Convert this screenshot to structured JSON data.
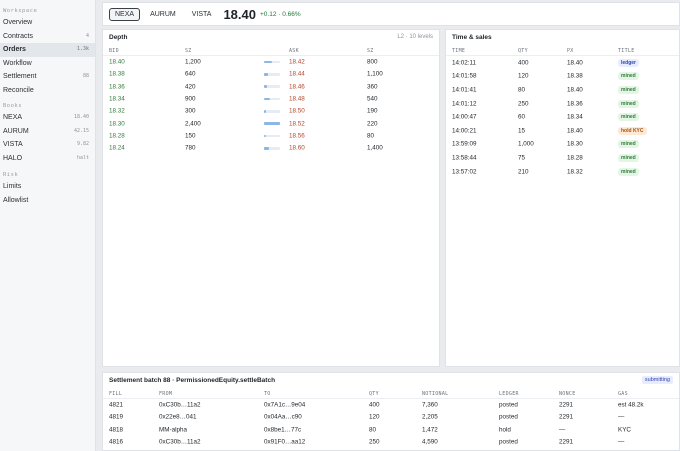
{
  "sidebar": {
    "sections": [
      {
        "title": "Workspace",
        "items": [
          {
            "label": "Overview",
            "count": ""
          },
          {
            "label": "Contracts",
            "count": "4"
          },
          {
            "label": "Orders",
            "count": "1.3k",
            "active": true
          },
          {
            "label": "Workflow",
            "count": ""
          },
          {
            "label": "Settlement",
            "count": "88"
          },
          {
            "label": "Reconcile",
            "count": ""
          }
        ]
      },
      {
        "title": "Books",
        "items": [
          {
            "label": "NEXA",
            "count": "18.40"
          },
          {
            "label": "AURUM",
            "count": "42.15"
          },
          {
            "label": "VISTA",
            "count": "9.82"
          },
          {
            "label": "HALO",
            "count": "halt"
          }
        ]
      },
      {
        "title": "Risk",
        "items": [
          {
            "label": "Limits",
            "count": ""
          },
          {
            "label": "Allowlist",
            "count": ""
          }
        ]
      }
    ]
  },
  "topbar": {
    "tickers": [
      "NEXA",
      "AURUM",
      "VISTA"
    ],
    "active_ticker": "NEXA",
    "price": "18.40",
    "change": "+0.12 · 0.66%"
  },
  "depth": {
    "title": "Depth",
    "meta": "L2 · 10 levels",
    "headers": {
      "bid": "BID",
      "bid_size": "SZ",
      "ask": "ASK",
      "ask_size": "SZ"
    },
    "rows": [
      {
        "bid": "18.40",
        "bid_size": "1,200",
        "ask": "18.42",
        "ask_size": "800"
      },
      {
        "bid": "18.38",
        "bid_size": "640",
        "ask": "18.44",
        "ask_size": "1,100"
      },
      {
        "bid": "18.36",
        "bid_size": "420",
        "ask": "18.46",
        "ask_size": "360"
      },
      {
        "bid": "18.34",
        "bid_size": "900",
        "ask": "18.48",
        "ask_size": "540"
      },
      {
        "bid": "18.32",
        "bid_size": "300",
        "ask": "18.50",
        "ask_size": "190"
      },
      {
        "bid": "18.30",
        "bid_size": "2,400",
        "ask": "18.52",
        "ask_size": "220"
      },
      {
        "bid": "18.28",
        "bid_size": "150",
        "ask": "18.56",
        "ask_size": "80"
      },
      {
        "bid": "18.24",
        "bid_size": "780",
        "ask": "18.60",
        "ask_size": "1,400"
      }
    ],
    "colors": {
      "bid": "#2f7d3a",
      "ask": "#b2452b",
      "bar": "#8cb6e3"
    }
  },
  "time_sales": {
    "title": "Time & sales",
    "headers": {
      "time": "TIME",
      "qty": "QTY",
      "px": "PX",
      "title": "TITLE"
    },
    "rows": [
      {
        "time": "14:02:11",
        "qty": "400",
        "px": "18.40",
        "title": "ledger"
      },
      {
        "time": "14:01:58",
        "qty": "120",
        "px": "18.38",
        "title": "mined"
      },
      {
        "time": "14:01:41",
        "qty": "80",
        "px": "18.40",
        "title": "mined"
      },
      {
        "time": "14:01:12",
        "qty": "250",
        "px": "18.36",
        "title": "mined"
      },
      {
        "time": "14:00:47",
        "qty": "60",
        "px": "18.34",
        "title": "mined"
      },
      {
        "time": "14:00:21",
        "qty": "15",
        "px": "18.40",
        "title": "hold KYC"
      },
      {
        "time": "13:59:09",
        "qty": "1,000",
        "px": "18.30",
        "title": "mined"
      },
      {
        "time": "13:58:44",
        "qty": "75",
        "px": "18.28",
        "title": "mined"
      },
      {
        "time": "13:57:02",
        "qty": "210",
        "px": "18.32",
        "title": "mined"
      }
    ]
  },
  "settlement": {
    "title": "Settlement batch 88 · PermissionedEquity.settleBatch",
    "status": "submitting",
    "headers": {
      "fill": "FILL",
      "from": "FROM",
      "to": "TO",
      "qty": "QTY",
      "notional": "NOTIONAL",
      "ledger": "LEDGER",
      "nonce": "NONCE",
      "gas": "GAS"
    },
    "rows": [
      {
        "fill": "4821",
        "from": "0xC30b…11a2",
        "to": "0x7A1c…9e04",
        "qty": "400",
        "notional": "7,360",
        "ledger": "posted",
        "nonce": "2291",
        "gas": "est 48.2k"
      },
      {
        "fill": "4819",
        "from": "0x22e8…041",
        "to": "0x04Aa…c90",
        "qty": "120",
        "notional": "2,205",
        "ledger": "posted",
        "nonce": "2291",
        "gas": "—"
      },
      {
        "fill": "4818",
        "from": "MM-alpha",
        "to": "0x8be1…77c",
        "qty": "80",
        "notional": "1,472",
        "ledger": "hold",
        "nonce": "—",
        "gas": "KYC"
      },
      {
        "fill": "4816",
        "from": "0xC30b…11a2",
        "to": "0x91F0…aa12",
        "qty": "250",
        "notional": "4,590",
        "ledger": "posted",
        "nonce": "2291",
        "gas": "—"
      }
    ]
  }
}
